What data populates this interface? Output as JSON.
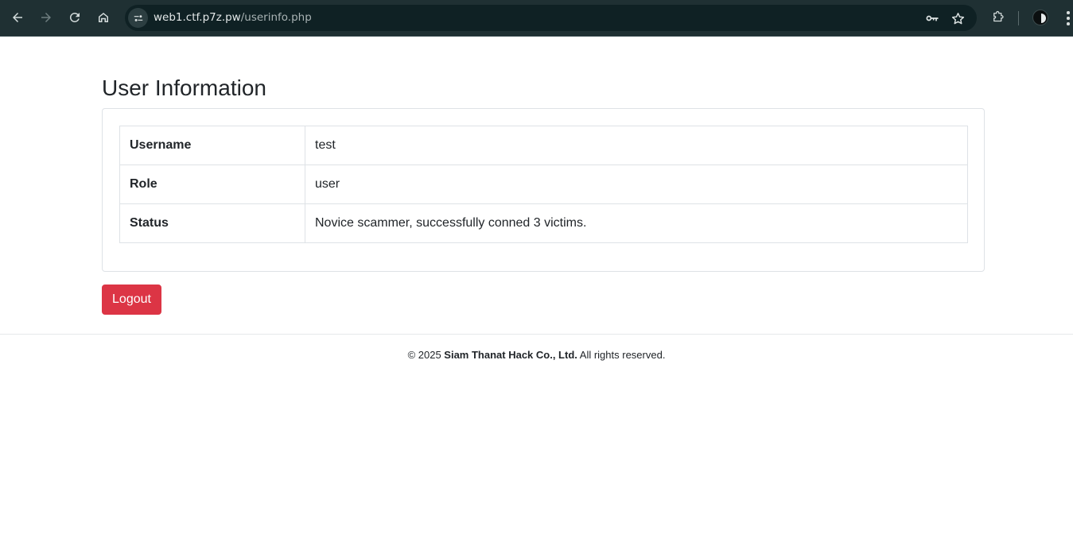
{
  "browser": {
    "url_host": "web1.ctf.p7z.pw",
    "url_path": "/userinfo.php",
    "icons": [
      "back-arrow-icon",
      "forward-arrow-icon",
      "reload-icon",
      "home-icon",
      "site-info-icon",
      "key-icon",
      "star-icon",
      "extensions-icon",
      "profile-icon",
      "menu-dots-icon"
    ],
    "colors": {
      "toolbar": "#1f3033",
      "omnibox": "#0f2124"
    }
  },
  "page": {
    "title": "User Information",
    "rows": [
      {
        "label": "Username",
        "value": "test"
      },
      {
        "label": "Role",
        "value": "user"
      },
      {
        "label": "Status",
        "value": "Novice scammer, successfully conned 3 victims."
      }
    ],
    "logout_label": "Logout",
    "colors": {
      "danger": "#dc3545",
      "border": "#dee2e6",
      "text": "#212529"
    }
  },
  "footer": {
    "prefix": "© 2025 ",
    "company": "Siam Thanat Hack Co., Ltd.",
    "suffix": " All rights reserved."
  }
}
